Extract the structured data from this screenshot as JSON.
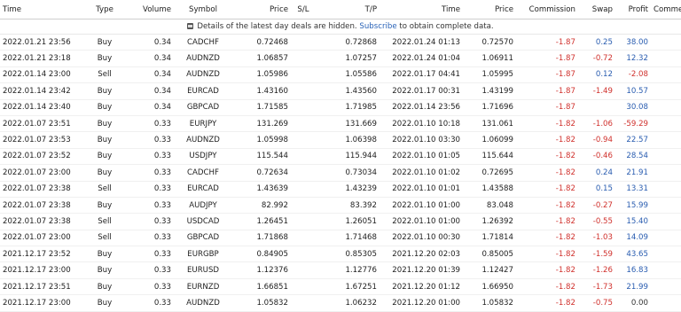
{
  "headers": [
    "Time",
    "Type",
    "Volume",
    "Symbol",
    "Price",
    "S/L",
    "T/P",
    "Time",
    "Price",
    "Commission",
    "Swap",
    "Profit",
    "Comment"
  ],
  "notice": {
    "before": "Details of the latest day deals are hidden.",
    "link": "Subscribe",
    "after": "to obtain complete data."
  },
  "rows": [
    {
      "open_time": "2022.01.21 23:56",
      "type": "Buy",
      "volume": "0.34",
      "symbol": "CADCHF",
      "open_price": "0.72468",
      "sl": "",
      "tp": "0.72868",
      "close_time": "2022.01.24 01:13",
      "close_price": "0.72570",
      "commission": "-1.87",
      "swap": "0.25",
      "profit": "38.00"
    },
    {
      "open_time": "2022.01.21 23:18",
      "type": "Buy",
      "volume": "0.34",
      "symbol": "AUDNZD",
      "open_price": "1.06857",
      "sl": "",
      "tp": "1.07257",
      "close_time": "2022.01.24 01:04",
      "close_price": "1.06911",
      "commission": "-1.87",
      "swap": "-0.72",
      "profit": "12.32"
    },
    {
      "open_time": "2022.01.14 23:00",
      "type": "Sell",
      "volume": "0.34",
      "symbol": "AUDNZD",
      "open_price": "1.05986",
      "sl": "",
      "tp": "1.05586",
      "close_time": "2022.01.17 04:41",
      "close_price": "1.05995",
      "commission": "-1.87",
      "swap": "0.12",
      "profit": "-2.08"
    },
    {
      "open_time": "2022.01.14 23:42",
      "type": "Buy",
      "volume": "0.34",
      "symbol": "EURCAD",
      "open_price": "1.43160",
      "sl": "",
      "tp": "1.43560",
      "close_time": "2022.01.17 00:31",
      "close_price": "1.43199",
      "commission": "-1.87",
      "swap": "-1.49",
      "profit": "10.57"
    },
    {
      "open_time": "2022.01.14 23:40",
      "type": "Buy",
      "volume": "0.34",
      "symbol": "GBPCAD",
      "open_price": "1.71585",
      "sl": "",
      "tp": "1.71985",
      "close_time": "2022.01.14 23:56",
      "close_price": "1.71696",
      "commission": "-1.87",
      "swap": "",
      "profit": "30.08"
    },
    {
      "open_time": "2022.01.07 23:51",
      "type": "Buy",
      "volume": "0.33",
      "symbol": "EURJPY",
      "open_price": "131.269",
      "sl": "",
      "tp": "131.669",
      "close_time": "2022.01.10 10:18",
      "close_price": "131.061",
      "commission": "-1.82",
      "swap": "-1.06",
      "profit": "-59.29"
    },
    {
      "open_time": "2022.01.07 23:53",
      "type": "Buy",
      "volume": "0.33",
      "symbol": "AUDNZD",
      "open_price": "1.05998",
      "sl": "",
      "tp": "1.06398",
      "close_time": "2022.01.10 03:30",
      "close_price": "1.06099",
      "commission": "-1.82",
      "swap": "-0.94",
      "profit": "22.57"
    },
    {
      "open_time": "2022.01.07 23:52",
      "type": "Buy",
      "volume": "0.33",
      "symbol": "USDJPY",
      "open_price": "115.544",
      "sl": "",
      "tp": "115.944",
      "close_time": "2022.01.10 01:05",
      "close_price": "115.644",
      "commission": "-1.82",
      "swap": "-0.46",
      "profit": "28.54"
    },
    {
      "open_time": "2022.01.07 23:00",
      "type": "Buy",
      "volume": "0.33",
      "symbol": "CADCHF",
      "open_price": "0.72634",
      "sl": "",
      "tp": "0.73034",
      "close_time": "2022.01.10 01:02",
      "close_price": "0.72695",
      "commission": "-1.82",
      "swap": "0.24",
      "profit": "21.91"
    },
    {
      "open_time": "2022.01.07 23:38",
      "type": "Sell",
      "volume": "0.33",
      "symbol": "EURCAD",
      "open_price": "1.43639",
      "sl": "",
      "tp": "1.43239",
      "close_time": "2022.01.10 01:01",
      "close_price": "1.43588",
      "commission": "-1.82",
      "swap": "0.15",
      "profit": "13.31"
    },
    {
      "open_time": "2022.01.07 23:38",
      "type": "Buy",
      "volume": "0.33",
      "symbol": "AUDJPY",
      "open_price": "82.992",
      "sl": "",
      "tp": "83.392",
      "close_time": "2022.01.10 01:00",
      "close_price": "83.048",
      "commission": "-1.82",
      "swap": "-0.27",
      "profit": "15.99"
    },
    {
      "open_time": "2022.01.07 23:38",
      "type": "Sell",
      "volume": "0.33",
      "symbol": "USDCAD",
      "open_price": "1.26451",
      "sl": "",
      "tp": "1.26051",
      "close_time": "2022.01.10 01:00",
      "close_price": "1.26392",
      "commission": "-1.82",
      "swap": "-0.55",
      "profit": "15.40"
    },
    {
      "open_time": "2022.01.07 23:00",
      "type": "Sell",
      "volume": "0.33",
      "symbol": "GBPCAD",
      "open_price": "1.71868",
      "sl": "",
      "tp": "1.71468",
      "close_time": "2022.01.10 00:30",
      "close_price": "1.71814",
      "commission": "-1.82",
      "swap": "-1.03",
      "profit": "14.09"
    },
    {
      "open_time": "2021.12.17 23:52",
      "type": "Buy",
      "volume": "0.33",
      "symbol": "EURGBP",
      "open_price": "0.84905",
      "sl": "",
      "tp": "0.85305",
      "close_time": "2021.12.20 02:03",
      "close_price": "0.85005",
      "commission": "-1.82",
      "swap": "-1.59",
      "profit": "43.65"
    },
    {
      "open_time": "2021.12.17 23:00",
      "type": "Buy",
      "volume": "0.33",
      "symbol": "EURUSD",
      "open_price": "1.12376",
      "sl": "",
      "tp": "1.12776",
      "close_time": "2021.12.20 01:39",
      "close_price": "1.12427",
      "commission": "-1.82",
      "swap": "-1.26",
      "profit": "16.83"
    },
    {
      "open_time": "2021.12.17 23:51",
      "type": "Buy",
      "volume": "0.33",
      "symbol": "EURNZD",
      "open_price": "1.66851",
      "sl": "",
      "tp": "1.67251",
      "close_time": "2021.12.20 01:12",
      "close_price": "1.66950",
      "commission": "-1.82",
      "swap": "-1.73",
      "profit": "21.99"
    },
    {
      "open_time": "2021.12.17 23:00",
      "type": "Buy",
      "volume": "0.33",
      "symbol": "AUDNZD",
      "open_price": "1.05832",
      "sl": "",
      "tp": "1.06232",
      "close_time": "2021.12.20 01:00",
      "close_price": "1.05832",
      "commission": "-1.82",
      "swap": "-0.75",
      "profit": "0.00"
    }
  ],
  "colors": {
    "negative": "#d0312d",
    "positive": "#2a5db0",
    "link": "#2a63b8"
  }
}
